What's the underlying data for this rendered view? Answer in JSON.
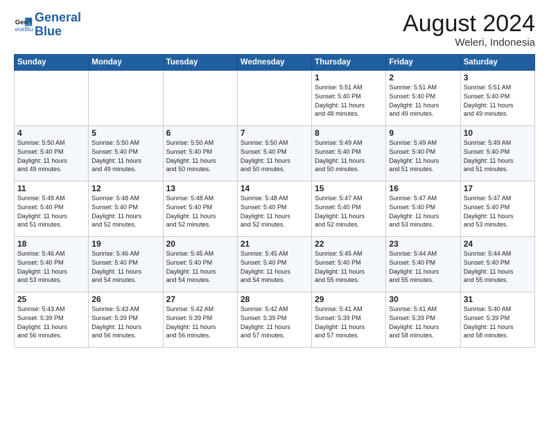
{
  "logo": {
    "line1": "General",
    "line2": "Blue"
  },
  "title": "August 2024",
  "subtitle": "Weleri, Indonesia",
  "header": {
    "days": [
      "Sunday",
      "Monday",
      "Tuesday",
      "Wednesday",
      "Thursday",
      "Friday",
      "Saturday"
    ]
  },
  "weeks": [
    {
      "cells": [
        {
          "day": null,
          "info": null
        },
        {
          "day": null,
          "info": null
        },
        {
          "day": null,
          "info": null
        },
        {
          "day": null,
          "info": null
        },
        {
          "day": "1",
          "info": "Sunrise: 5:51 AM\nSunset: 5:40 PM\nDaylight: 11 hours\nand 48 minutes."
        },
        {
          "day": "2",
          "info": "Sunrise: 5:51 AM\nSunset: 5:40 PM\nDaylight: 11 hours\nand 49 minutes."
        },
        {
          "day": "3",
          "info": "Sunrise: 5:51 AM\nSunset: 5:40 PM\nDaylight: 11 hours\nand 49 minutes."
        }
      ]
    },
    {
      "cells": [
        {
          "day": "4",
          "info": "Sunrise: 5:50 AM\nSunset: 5:40 PM\nDaylight: 11 hours\nand 49 minutes."
        },
        {
          "day": "5",
          "info": "Sunrise: 5:50 AM\nSunset: 5:40 PM\nDaylight: 11 hours\nand 49 minutes."
        },
        {
          "day": "6",
          "info": "Sunrise: 5:50 AM\nSunset: 5:40 PM\nDaylight: 11 hours\nand 50 minutes."
        },
        {
          "day": "7",
          "info": "Sunrise: 5:50 AM\nSunset: 5:40 PM\nDaylight: 11 hours\nand 50 minutes."
        },
        {
          "day": "8",
          "info": "Sunrise: 5:49 AM\nSunset: 5:40 PM\nDaylight: 11 hours\nand 50 minutes."
        },
        {
          "day": "9",
          "info": "Sunrise: 5:49 AM\nSunset: 5:40 PM\nDaylight: 11 hours\nand 51 minutes."
        },
        {
          "day": "10",
          "info": "Sunrise: 5:49 AM\nSunset: 5:40 PM\nDaylight: 11 hours\nand 51 minutes."
        }
      ]
    },
    {
      "cells": [
        {
          "day": "11",
          "info": "Sunrise: 5:49 AM\nSunset: 5:40 PM\nDaylight: 11 hours\nand 51 minutes."
        },
        {
          "day": "12",
          "info": "Sunrise: 5:48 AM\nSunset: 5:40 PM\nDaylight: 11 hours\nand 52 minutes."
        },
        {
          "day": "13",
          "info": "Sunrise: 5:48 AM\nSunset: 5:40 PM\nDaylight: 11 hours\nand 52 minutes."
        },
        {
          "day": "14",
          "info": "Sunrise: 5:48 AM\nSunset: 5:40 PM\nDaylight: 11 hours\nand 52 minutes."
        },
        {
          "day": "15",
          "info": "Sunrise: 5:47 AM\nSunset: 5:40 PM\nDaylight: 11 hours\nand 52 minutes."
        },
        {
          "day": "16",
          "info": "Sunrise: 5:47 AM\nSunset: 5:40 PM\nDaylight: 11 hours\nand 53 minutes."
        },
        {
          "day": "17",
          "info": "Sunrise: 5:47 AM\nSunset: 5:40 PM\nDaylight: 11 hours\nand 53 minutes."
        }
      ]
    },
    {
      "cells": [
        {
          "day": "18",
          "info": "Sunrise: 5:46 AM\nSunset: 5:40 PM\nDaylight: 11 hours\nand 53 minutes."
        },
        {
          "day": "19",
          "info": "Sunrise: 5:46 AM\nSunset: 5:40 PM\nDaylight: 11 hours\nand 54 minutes."
        },
        {
          "day": "20",
          "info": "Sunrise: 5:45 AM\nSunset: 5:40 PM\nDaylight: 11 hours\nand 54 minutes."
        },
        {
          "day": "21",
          "info": "Sunrise: 5:45 AM\nSunset: 5:40 PM\nDaylight: 11 hours\nand 54 minutes."
        },
        {
          "day": "22",
          "info": "Sunrise: 5:45 AM\nSunset: 5:40 PM\nDaylight: 11 hours\nand 55 minutes."
        },
        {
          "day": "23",
          "info": "Sunrise: 5:44 AM\nSunset: 5:40 PM\nDaylight: 11 hours\nand 55 minutes."
        },
        {
          "day": "24",
          "info": "Sunrise: 5:44 AM\nSunset: 5:40 PM\nDaylight: 11 hours\nand 55 minutes."
        }
      ]
    },
    {
      "cells": [
        {
          "day": "25",
          "info": "Sunrise: 5:43 AM\nSunset: 5:39 PM\nDaylight: 11 hours\nand 56 minutes."
        },
        {
          "day": "26",
          "info": "Sunrise: 5:43 AM\nSunset: 5:39 PM\nDaylight: 11 hours\nand 56 minutes."
        },
        {
          "day": "27",
          "info": "Sunrise: 5:42 AM\nSunset: 5:39 PM\nDaylight: 11 hours\nand 56 minutes."
        },
        {
          "day": "28",
          "info": "Sunrise: 5:42 AM\nSunset: 5:39 PM\nDaylight: 11 hours\nand 57 minutes."
        },
        {
          "day": "29",
          "info": "Sunrise: 5:41 AM\nSunset: 5:39 PM\nDaylight: 11 hours\nand 57 minutes."
        },
        {
          "day": "30",
          "info": "Sunrise: 5:41 AM\nSunset: 5:39 PM\nDaylight: 11 hours\nand 58 minutes."
        },
        {
          "day": "31",
          "info": "Sunrise: 5:40 AM\nSunset: 5:39 PM\nDaylight: 11 hours\nand 58 minutes."
        }
      ]
    }
  ]
}
